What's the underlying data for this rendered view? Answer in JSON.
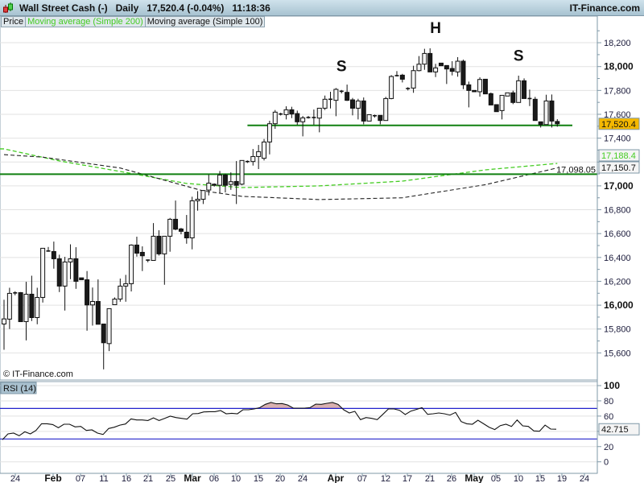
{
  "header": {
    "instrument": "Wall Street Cash (-)",
    "period": "Daily",
    "last": "17,520.4 (-0.04%)",
    "time": "11:18:36",
    "brand": "IT-Finance.com"
  },
  "legend": [
    "Price",
    "Moving average (Simple 200)",
    "Moving average (Simple 100)"
  ],
  "copyright": "© IT-Finance.com",
  "rsi_label": "RSI (14)",
  "colors": {
    "ma200": "#44cc22",
    "ma100": "#222222",
    "support": "#108010",
    "rsi_bounds": "#2222cc",
    "overbought_fill": "#d8b0b0",
    "last_box": "#f5b800"
  },
  "chart_data": [
    {
      "type": "candlestick",
      "title": "Wall Street Cash (-) Daily",
      "ylim": [
        15400,
        18350
      ],
      "yticks": [
        "15,600",
        "15,800",
        "16,000",
        "16,200",
        "16,400",
        "16,600",
        "16,800",
        "17,000",
        "17,200",
        "17,400",
        "17,600",
        "17,800",
        "18,000",
        "18,200"
      ],
      "ytick_values": [
        15600,
        15800,
        16000,
        16200,
        16400,
        16600,
        16800,
        17000,
        17200,
        17400,
        17600,
        17800,
        18000,
        18200
      ],
      "xticks": [
        "24",
        "Feb",
        "07",
        "11",
        "16",
        "21",
        "25",
        "Mar",
        "06",
        "10",
        "15",
        "20",
        "24",
        "Apr",
        "07",
        "12",
        "17",
        "21",
        "26",
        "May",
        "05",
        "10",
        "15",
        "19",
        "24"
      ],
      "ohlc_fields": [
        "open",
        "high",
        "low",
        "close"
      ],
      "candles": [
        [
          15842,
          16045,
          15626,
          15885
        ],
        [
          15883,
          16146,
          15800,
          16099
        ],
        [
          16103,
          16117,
          16083,
          16103
        ],
        [
          16105,
          16110,
          15862,
          15862
        ],
        [
          15862,
          16196,
          15705,
          16092
        ],
        [
          16092,
          16247,
          15867,
          15896
        ],
        [
          15896,
          16146,
          15840,
          16065
        ],
        [
          16065,
          16477,
          16022,
          16477
        ],
        [
          16454,
          16488,
          16448,
          16454
        ],
        [
          16450,
          16533,
          16306,
          16389
        ],
        [
          16389,
          16423,
          16110,
          16160
        ],
        [
          16160,
          16405,
          15955,
          16362
        ],
        [
          16362,
          16510,
          16218,
          16389
        ],
        [
          16389,
          16486,
          16137,
          16200
        ],
        [
          16229,
          16229,
          16211,
          16213
        ],
        [
          16213,
          16286,
          15786,
          16002
        ],
        [
          16002,
          16148,
          15829,
          16031
        ],
        [
          16031,
          16216,
          15840,
          15840
        ],
        [
          15842,
          15842,
          15462,
          15685
        ],
        [
          15678,
          15971,
          15615,
          15971
        ],
        [
          16004,
          16065,
          16004,
          16051
        ],
        [
          16051,
          16223,
          16029,
          16160
        ],
        [
          16160,
          16254,
          16029,
          16180
        ],
        [
          16180,
          16510,
          16115,
          16504
        ],
        [
          16504,
          16574,
          16407,
          16436
        ],
        [
          16443,
          16493,
          16286,
          16414
        ],
        [
          16378,
          16383,
          16360,
          16376
        ],
        [
          16375,
          16688,
          16375,
          16578
        ],
        [
          16578,
          16628,
          16416,
          16430
        ],
        [
          16430,
          16578,
          16171,
          16578
        ],
        [
          16578,
          16731,
          16448,
          16720
        ],
        [
          16720,
          16877,
          16628,
          16637
        ],
        [
          16639,
          16648,
          16594,
          16619
        ],
        [
          16612,
          16756,
          16515,
          16564
        ],
        [
          16564,
          16909,
          16468,
          16875
        ],
        [
          16875,
          16956,
          16792,
          16888
        ],
        [
          16888,
          16965,
          16848,
          16961
        ],
        [
          16965,
          17095,
          16920,
          17023
        ],
        [
          17014,
          17021,
          16994,
          17005
        ],
        [
          17005,
          17125,
          16938,
          17091
        ],
        [
          17091,
          17102,
          16945,
          17005
        ],
        [
          17012,
          17113,
          16967,
          17035
        ],
        [
          17037,
          17208,
          16848,
          17005
        ],
        [
          17014,
          17213,
          17005,
          17213
        ],
        [
          17204,
          17213,
          17192,
          17204
        ],
        [
          17204,
          17309,
          17170,
          17246
        ],
        [
          17246,
          17343,
          17141,
          17287
        ],
        [
          17231,
          17393,
          17213,
          17368
        ],
        [
          17368,
          17546,
          17264,
          17521
        ],
        [
          17521,
          17636,
          17478,
          17618
        ],
        [
          17602,
          17613,
          17590,
          17602
        ],
        [
          17597,
          17667,
          17557,
          17638
        ],
        [
          17638,
          17663,
          17568,
          17602
        ],
        [
          17606,
          17631,
          17512,
          17537
        ],
        [
          17537,
          17586,
          17415,
          17570
        ],
        [
          17573,
          17586,
          17564,
          17573
        ],
        [
          17573,
          17640,
          17512,
          17573
        ],
        [
          17568,
          17651,
          17449,
          17651
        ],
        [
          17651,
          17757,
          17636,
          17726
        ],
        [
          17726,
          17789,
          17649,
          17726
        ],
        [
          17717,
          17820,
          17584,
          17809
        ],
        [
          17793,
          17804,
          17775,
          17793
        ],
        [
          17784,
          17849,
          17712,
          17717
        ],
        [
          17721,
          17737,
          17591,
          17651
        ],
        [
          17651,
          17730,
          17557,
          17712
        ],
        [
          17712,
          17741,
          17516,
          17543
        ],
        [
          17543,
          17597,
          17543,
          17597
        ],
        [
          17588,
          17597,
          17573,
          17588
        ],
        [
          17591,
          17591,
          17516,
          17548
        ],
        [
          17548,
          17746,
          17548,
          17732
        ],
        [
          17732,
          17928,
          17726,
          17917
        ],
        [
          17924,
          17962,
          17917,
          17924
        ],
        [
          17928,
          17939,
          17867,
          17894
        ],
        [
          17816,
          17827,
          17800,
          17816
        ],
        [
          17820,
          18007,
          17780,
          17966
        ],
        [
          17966,
          18088,
          17960,
          18020
        ],
        [
          18020,
          18149,
          17973,
          18110
        ],
        [
          18110,
          18153,
          17955,
          17955
        ],
        [
          17955,
          18023,
          17912,
          17989
        ],
        [
          18029,
          18029,
          18007,
          18007
        ],
        [
          18009,
          18009,
          17854,
          17980
        ],
        [
          17984,
          18045,
          17926,
          17960
        ],
        [
          17955,
          18079,
          17915,
          18045
        ],
        [
          18045,
          18058,
          17811,
          17847
        ],
        [
          17847,
          17874,
          17658,
          17800
        ],
        [
          17800,
          17800,
          17789,
          17789
        ],
        [
          17789,
          17910,
          17748,
          17892
        ],
        [
          17894,
          17894,
          17771,
          17771
        ],
        [
          17773,
          17782,
          17678,
          17678
        ],
        [
          17681,
          17681,
          17622,
          17622
        ],
        [
          17631,
          17759,
          17557,
          17759
        ],
        [
          17753,
          17780,
          17753,
          17780
        ],
        [
          17780,
          17798,
          17685,
          17699
        ],
        [
          17699,
          17924,
          17699,
          17881
        ],
        [
          17881,
          17901,
          17732,
          17732
        ],
        [
          17732,
          17807,
          17669,
          17732
        ],
        [
          17726,
          17746,
          17548,
          17548
        ],
        [
          17537,
          17537,
          17489,
          17514
        ],
        [
          17514,
          17764,
          17514,
          17712
        ],
        [
          17712,
          17766,
          17489,
          17543
        ],
        [
          17540,
          17559,
          17496,
          17520.4
        ]
      ],
      "ma200": {
        "name": "Moving average (Simple 200)",
        "points": [
          [
            0,
            17310
          ],
          [
            10,
            17209
          ],
          [
            21,
            17121
          ],
          [
            33,
            17020
          ],
          [
            43,
            16986
          ],
          [
            57,
            17000
          ],
          [
            72,
            17040
          ],
          [
            87,
            17134
          ],
          [
            100,
            17188.4
          ]
        ],
        "last_label": "17,188.4"
      },
      "ma100": {
        "name": "Moving average (Simple 100)",
        "points": [
          [
            0,
            17262
          ],
          [
            7,
            17241
          ],
          [
            21,
            17150
          ],
          [
            36,
            16958
          ],
          [
            43,
            16912
          ],
          [
            57,
            16885
          ],
          [
            72,
            16900
          ],
          [
            87,
            17010
          ],
          [
            100,
            17150.7
          ]
        ],
        "last_label": "17,150.7"
      },
      "support_line": {
        "value": 17098.05,
        "label": "17,098.05"
      },
      "neckline": {
        "value": 17507,
        "from_index": 44,
        "to_index": 103
      },
      "pattern_labels": [
        {
          "text": "S",
          "index": 61,
          "price": 17960
        },
        {
          "text": "H",
          "index": 78,
          "price": 18280
        },
        {
          "text": "S",
          "index": 93,
          "price": 18050
        }
      ],
      "last_price": {
        "value": 17520.4,
        "label": "17,520.4"
      }
    },
    {
      "type": "line",
      "title": "RSI (14)",
      "ylim": [
        0,
        100
      ],
      "yticks": [
        "0",
        "20",
        "40",
        "60",
        "80",
        "100"
      ],
      "ytick_values": [
        0,
        20,
        40,
        60,
        80,
        100
      ],
      "levels": [
        70,
        30
      ],
      "last_label": "42.715",
      "values": [
        28.9,
        36.6,
        37.7,
        34.2,
        39.4,
        36.6,
        41.2,
        50.0,
        50.0,
        48.9,
        44.7,
        49.3,
        49.3,
        45.8,
        46.5,
        41.2,
        41.9,
        37.7,
        35.9,
        43.7,
        45.4,
        48.2,
        49.6,
        56.3,
        54.9,
        54.9,
        54.2,
        57.7,
        54.2,
        57.0,
        59.9,
        58.1,
        57.0,
        56.0,
        63.0,
        63.4,
        65.5,
        65.8,
        65.8,
        67.3,
        63.0,
        63.7,
        63.0,
        68.3,
        68.3,
        69.4,
        71.1,
        75.4,
        77.8,
        76.1,
        76.4,
        74.6,
        70.4,
        70.4,
        70.4,
        71.1,
        75.7,
        75.4,
        76.8,
        77.8,
        75.4,
        68.3,
        64.1,
        66.2,
        55.3,
        58.1,
        57.0,
        55.3,
        62.3,
        69.4,
        69.4,
        67.6,
        62.0,
        66.5,
        68.7,
        71.1,
        62.3,
        63.0,
        64.1,
        63.0,
        61.3,
        64.8,
        52.8,
        50.0,
        49.3,
        54.6,
        50.0,
        45.4,
        42.3,
        47.5,
        49.3,
        46.5,
        54.9,
        47.2,
        46.5,
        40.5,
        40.1,
        48.2,
        43.0,
        42.715
      ]
    }
  ]
}
